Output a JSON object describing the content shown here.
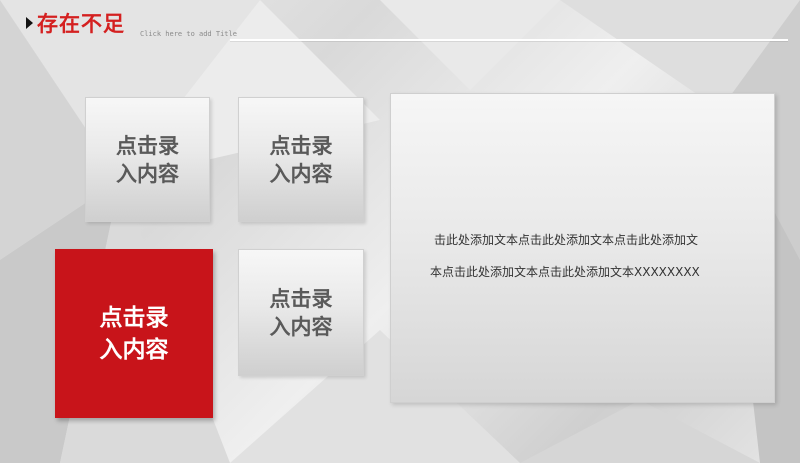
{
  "header": {
    "title": "存在不足",
    "subtitle": "Click here to add Title"
  },
  "tiles": [
    {
      "label": "点击录\n入内容",
      "style": "grey"
    },
    {
      "label": "点击录\n入内容",
      "style": "grey"
    },
    {
      "label": "点击录\n入内容",
      "style": "red"
    },
    {
      "label": "点击录\n入内容",
      "style": "grey"
    }
  ],
  "text_panel": {
    "line1": "击此处添加文本点击此处添加文本点击此处添加文",
    "line2": "本点击此处添加文本点击此处添加文本XXXXXXXX"
  },
  "colors": {
    "accent_red": "#c8141a",
    "title_red": "#d42020",
    "tile_text_grey": "#5a5a5a"
  }
}
